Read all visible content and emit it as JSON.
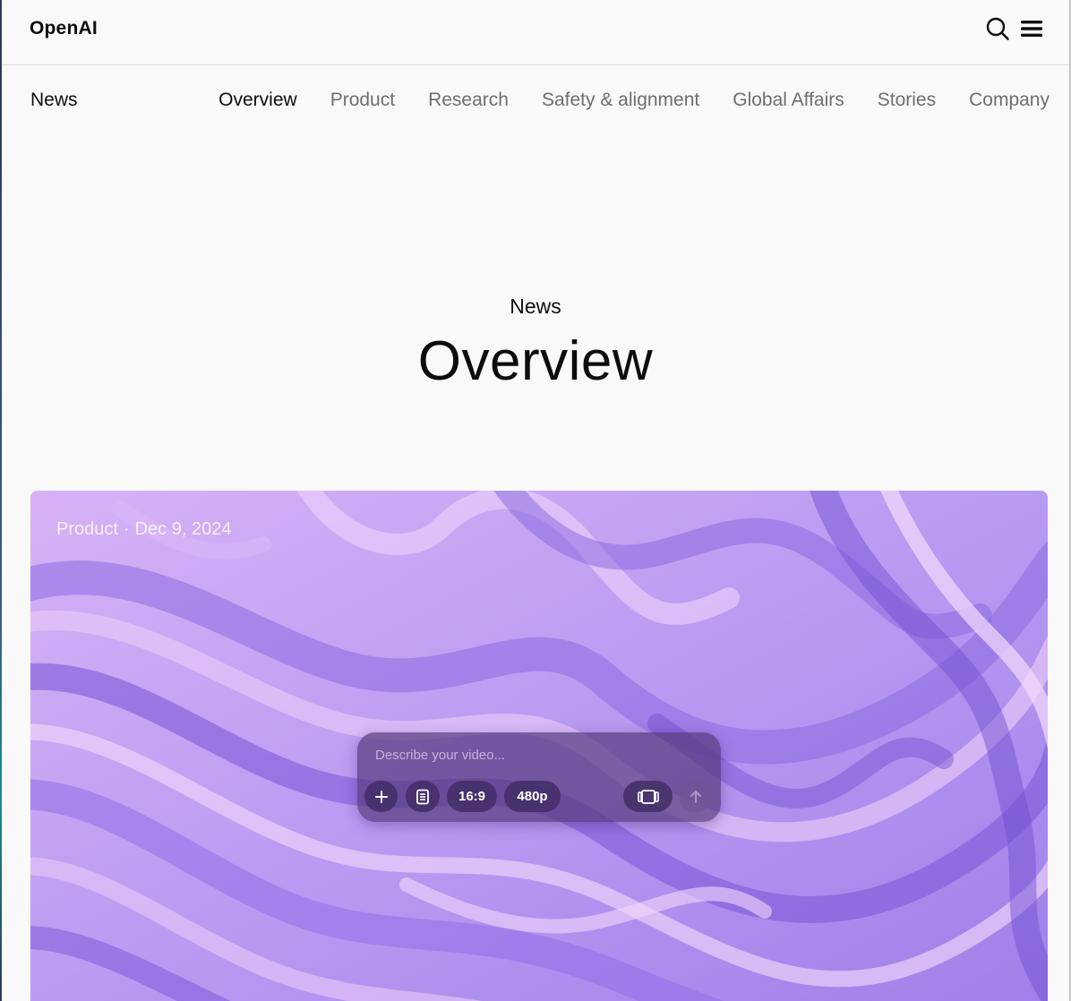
{
  "header": {
    "logo": "OpenAI",
    "search_icon": "search-icon",
    "menu_icon": "hamburger-menu-icon"
  },
  "subnav": {
    "title": "News",
    "links": [
      {
        "label": "Overview",
        "active": true
      },
      {
        "label": "Product",
        "active": false
      },
      {
        "label": "Research",
        "active": false
      },
      {
        "label": "Safety & alignment",
        "active": false
      },
      {
        "label": "Global Affairs",
        "active": false
      },
      {
        "label": "Stories",
        "active": false
      },
      {
        "label": "Company",
        "active": false
      }
    ]
  },
  "hero": {
    "eyebrow": "News",
    "title": "Overview"
  },
  "feature": {
    "category": "Product",
    "separator": "·",
    "date": "Dec 9, 2024",
    "prompt": {
      "placeholder": "Describe your video...",
      "add_icon": "plus-icon",
      "storyboard_icon": "storyboard-icon",
      "aspect_ratio": "16:9",
      "resolution": "480p",
      "variations_icon": "video-frames-icon",
      "submit_icon": "arrow-up-icon"
    }
  },
  "colors": {
    "background": "#f9f9f9",
    "text_primary": "#0d0d0d",
    "text_muted": "#6e6e6e",
    "card_purple": "#a98cf0"
  }
}
